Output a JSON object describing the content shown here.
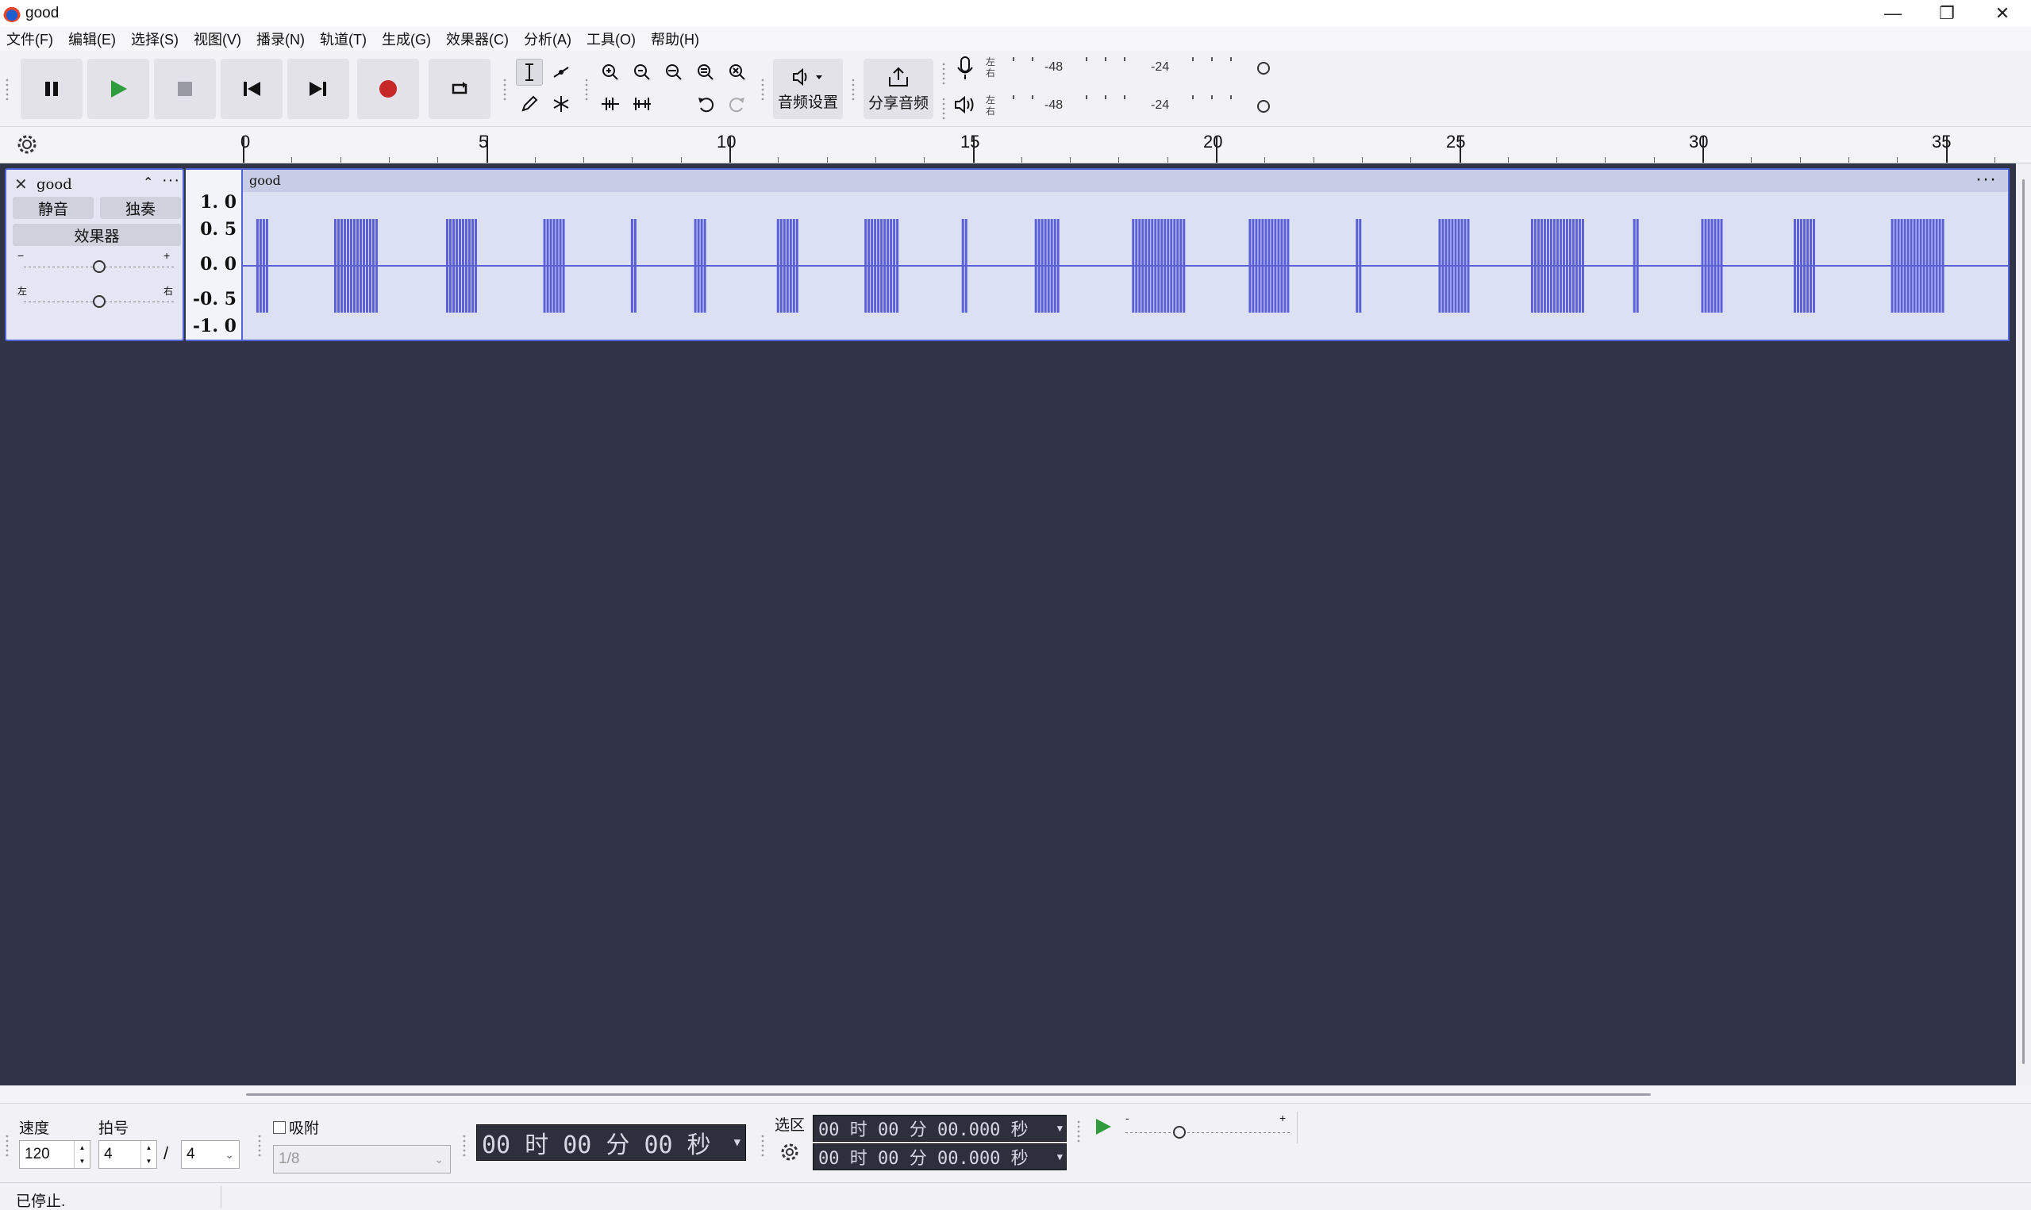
{
  "window": {
    "title": "good",
    "minimize": "—",
    "maximize": "❐",
    "close": "✕"
  },
  "menu": [
    "文件(F)",
    "编辑(E)",
    "选择(S)",
    "视图(V)",
    "播录(N)",
    "轨道(T)",
    "生成(G)",
    "效果器(C)",
    "分析(A)",
    "工具(O)",
    "帮助(H)"
  ],
  "toolbar": {
    "audio_setup_label": "音频设置",
    "share_audio_label": "分享音频",
    "record_meter": {
      "left": "左",
      "right": "右",
      "ticks": [
        "-48",
        "-24"
      ]
    },
    "play_meter": {
      "left": "左",
      "right": "右",
      "ticks": [
        "-48",
        "-24"
      ]
    },
    "colors": {
      "record": "#c62828",
      "play": "#2e9b3c",
      "waveform": "#5b5fd8"
    }
  },
  "ruler": {
    "labels": [
      "0",
      "5",
      "10",
      "15",
      "20",
      "25",
      "30",
      "35"
    ]
  },
  "track": {
    "name": "good",
    "mute_label": "静音",
    "solo_label": "独奏",
    "effects_label": "效果器",
    "gain_minus": "−",
    "gain_plus": "+",
    "pan_left": "左",
    "pan_right": "右",
    "gain_level": 0.5,
    "pan_level": 0.5,
    "scale_labels": [
      "1. 0",
      "0. 5",
      "0. 0",
      "-0. 5",
      "-1. 0"
    ],
    "clip_name": "good"
  },
  "waveform_bursts_seconds": [
    [
      0.3,
      0.5
    ],
    [
      1.9,
      2.8
    ],
    [
      4.2,
      4.8
    ],
    [
      6.2,
      6.6
    ],
    [
      8.0,
      8.1
    ],
    [
      9.3,
      9.5
    ],
    [
      11.0,
      11.4
    ],
    [
      12.8,
      13.5
    ],
    [
      14.8,
      14.9
    ],
    [
      16.3,
      16.8
    ],
    [
      18.3,
      19.4
    ],
    [
      20.7,
      21.5
    ],
    [
      22.9,
      23.0
    ],
    [
      24.6,
      25.2
    ],
    [
      26.5,
      27.6
    ],
    [
      28.6,
      28.7
    ],
    [
      30.0,
      30.4
    ],
    [
      31.9,
      32.3
    ],
    [
      33.9,
      35.0
    ]
  ],
  "bottom": {
    "tempo_label": "速度",
    "tempo_value": "120",
    "timesig_label": "拍号",
    "timesig_num": "4",
    "timesig_slash": "/",
    "timesig_den": "4",
    "snap_label": "吸附",
    "snap_value": "1/8",
    "time_display": "00 时 00 分 00 秒",
    "selection_label": "选区",
    "sel_start": "00 时 00 分 00.000 秒",
    "sel_end": "00 时 00 分 00.000 秒",
    "speed_minus": "-",
    "speed_plus": "+"
  },
  "status": {
    "text": "已停止."
  }
}
